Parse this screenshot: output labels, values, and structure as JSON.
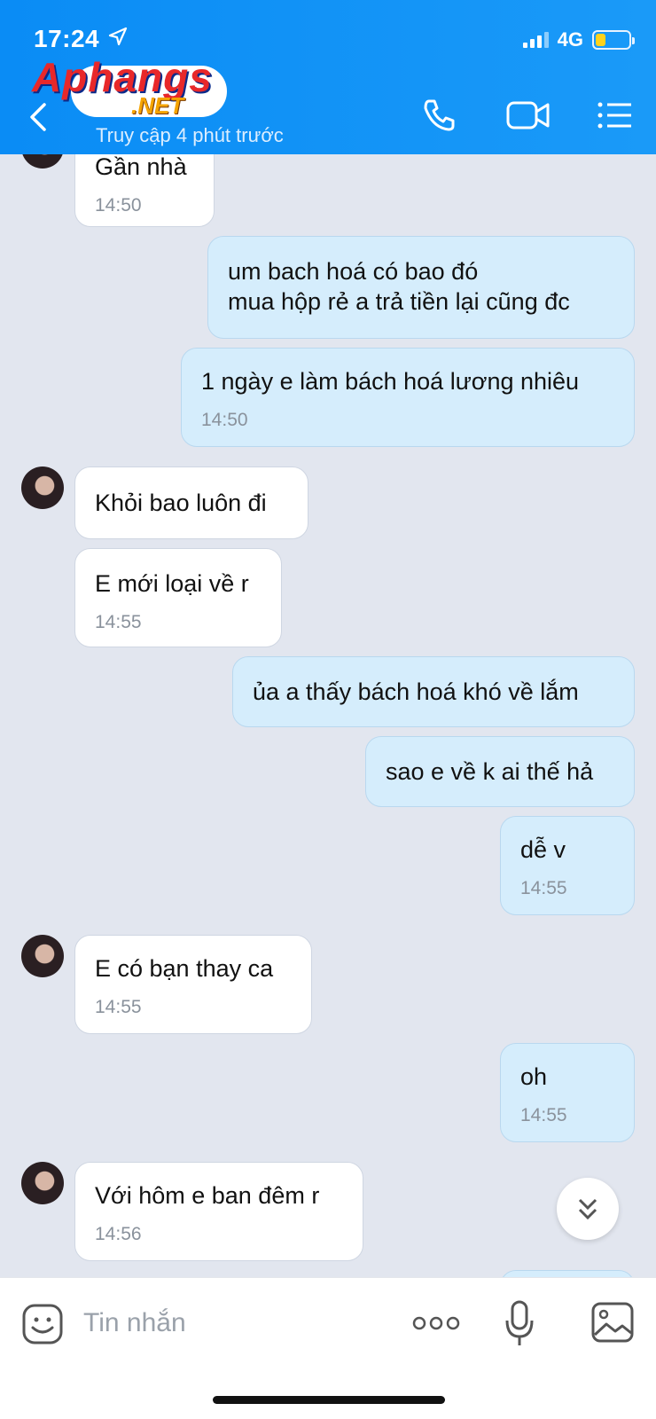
{
  "status_bar": {
    "time": "17:24",
    "network": "4G"
  },
  "header": {
    "logo_main": "Aphangs",
    "logo_sub": ".NET",
    "subtitle": "Truy cập 4 phút trước"
  },
  "messages": [
    {
      "dir": "in",
      "text": "Gần nhà",
      "time": "14:50"
    },
    {
      "dir": "out",
      "text": "um bach hoá có bao đó\nmua hộp rẻ a trả tiền lại cũng đc",
      "time": ""
    },
    {
      "dir": "out",
      "text": "1 ngày e làm bách hoá lương nhiêu",
      "time": "14:50"
    },
    {
      "dir": "in",
      "text": "Khỏi bao luôn đi",
      "time": ""
    },
    {
      "dir": "in",
      "text": "E mới loại về r",
      "time": "14:55"
    },
    {
      "dir": "out",
      "text": "ủa a thấy bách hoá khó về lắm",
      "time": ""
    },
    {
      "dir": "out",
      "text": "sao e về k ai thế hả",
      "time": ""
    },
    {
      "dir": "out",
      "text": "dễ v",
      "time": "14:55"
    },
    {
      "dir": "in",
      "text": "E có bạn thay ca",
      "time": "14:55"
    },
    {
      "dir": "out",
      "text": "oh",
      "time": "14:55"
    },
    {
      "dir": "in",
      "text": "Với hôm e ban đêm r",
      "time": "14:56"
    }
  ],
  "input": {
    "placeholder": "Tin nhắn"
  },
  "icons": {
    "back": "chevron-left-icon",
    "call": "phone-icon",
    "video": "video-icon",
    "menu": "list-icon",
    "sticker": "sticker-icon",
    "more": "more-icon",
    "mic": "mic-icon",
    "image": "image-icon",
    "scroll": "double-chevron-down-icon"
  },
  "colors": {
    "header": "#0a8cf5",
    "bubble_out": "#d5edfc",
    "bubble_in": "#ffffff",
    "background": "#e2e6ef"
  }
}
